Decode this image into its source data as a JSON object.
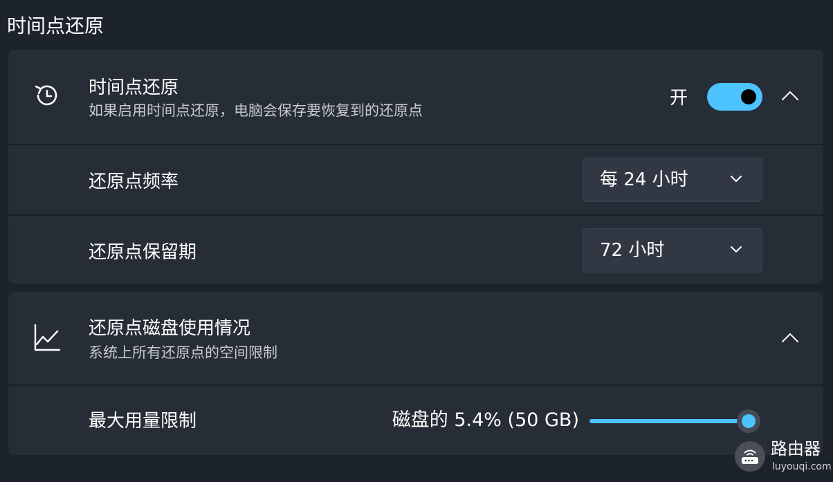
{
  "page": {
    "section_title": "时间点还原"
  },
  "restore_card": {
    "title": "时间点还原",
    "subtitle": "如果启用时间点还原，电脑会保存要恢复到的还原点",
    "toggle_state_label": "开",
    "toggle_on": true,
    "frequency": {
      "label": "还原点频率",
      "selected": "每 24 小时"
    },
    "retention": {
      "label": "还原点保留期",
      "selected": "72 小时"
    }
  },
  "disk_card": {
    "title": "还原点磁盘使用情况",
    "subtitle": "系统上所有还原点的空间限制",
    "max_usage": {
      "label": "最大用量限制",
      "readout": "磁盘的 5.4% (50 GB)",
      "slider_percent": 100
    }
  },
  "watermark": {
    "title": "路由器",
    "url": "luyouqi.com"
  },
  "colors": {
    "accent": "#4cc2ff",
    "background": "#1d232c",
    "card": "#262d36",
    "secondary_text": "#c7cbd1"
  },
  "icons": {
    "restore": "history-clock-icon",
    "disk_usage": "line-chart-icon",
    "collapse": "chevron-up-icon",
    "dropdown": "chevron-down-icon"
  }
}
